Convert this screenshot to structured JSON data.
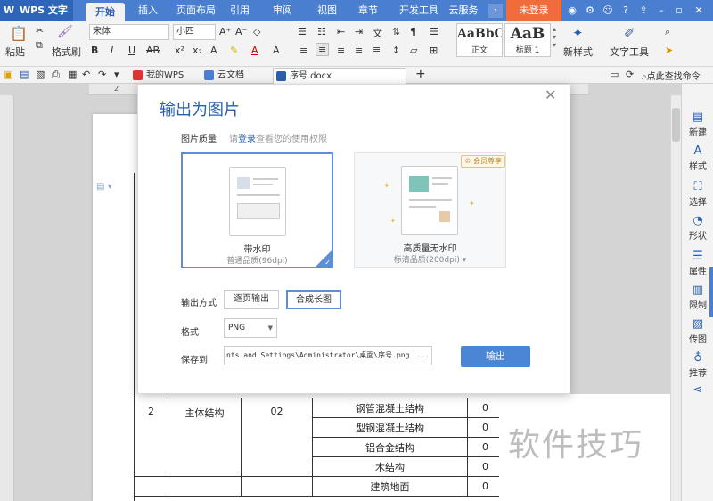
{
  "titlebar": {
    "app_name": "WPS 文字",
    "tabs": [
      "开始",
      "插入",
      "页面布局",
      "引用",
      "审阅",
      "视图",
      "章节",
      "开发工具",
      "云服务"
    ],
    "login": "未登录"
  },
  "ribbon": {
    "paste": "粘贴",
    "format_painter": "格式刷",
    "font": "宋体",
    "size": "小四",
    "styles": [
      {
        "sample": "AaBbCcI",
        "label": "正文"
      },
      {
        "sample": "AaB",
        "label": "标题 1"
      }
    ],
    "new_style": "新样式",
    "text_tools": "文字工具"
  },
  "doc_tabs": [
    "我的WPS",
    "云文档",
    "序号.docx"
  ],
  "search": "点此查找命令",
  "right_panel": [
    "新建",
    "样式",
    "选择",
    "形状",
    "属性",
    "限制",
    "传图",
    "推荐"
  ],
  "dialog": {
    "title": "输出为图片",
    "quality_label": "图片质量",
    "hint_prefix": "请",
    "hint_link": "登录",
    "hint_suffix": "查看您的使用权限",
    "card1": {
      "title": "带水印",
      "sub": "普通品质(96dpi)"
    },
    "card2": {
      "badge": "会员尊享",
      "title": "高质量无水印",
      "sub": "标清品质(200dpi)"
    },
    "output_label": "输出方式",
    "output_opts": [
      "逐页输出",
      "合成长图"
    ],
    "format_label": "格式",
    "format_value": "PNG",
    "save_label": "保存到",
    "save_path": "nts and Settings\\Administrator\\桌面\\序号.png",
    "save_more": "...",
    "export_btn": "输出"
  },
  "table": {
    "no": "2",
    "name": "主体结构",
    "code": "02",
    "items": [
      "钢管混凝土结构",
      "型钢混凝土结构",
      "铝合金结构",
      "木结构",
      "建筑地面"
    ],
    "codes": [
      "0",
      "0",
      "0",
      "0",
      "0"
    ]
  },
  "watermark": "软件技巧",
  "colors": {
    "accent": "#2a5fad",
    "titlebar": "#4a7fd0",
    "login": "#f06c3a",
    "export": "#4a85d6"
  }
}
